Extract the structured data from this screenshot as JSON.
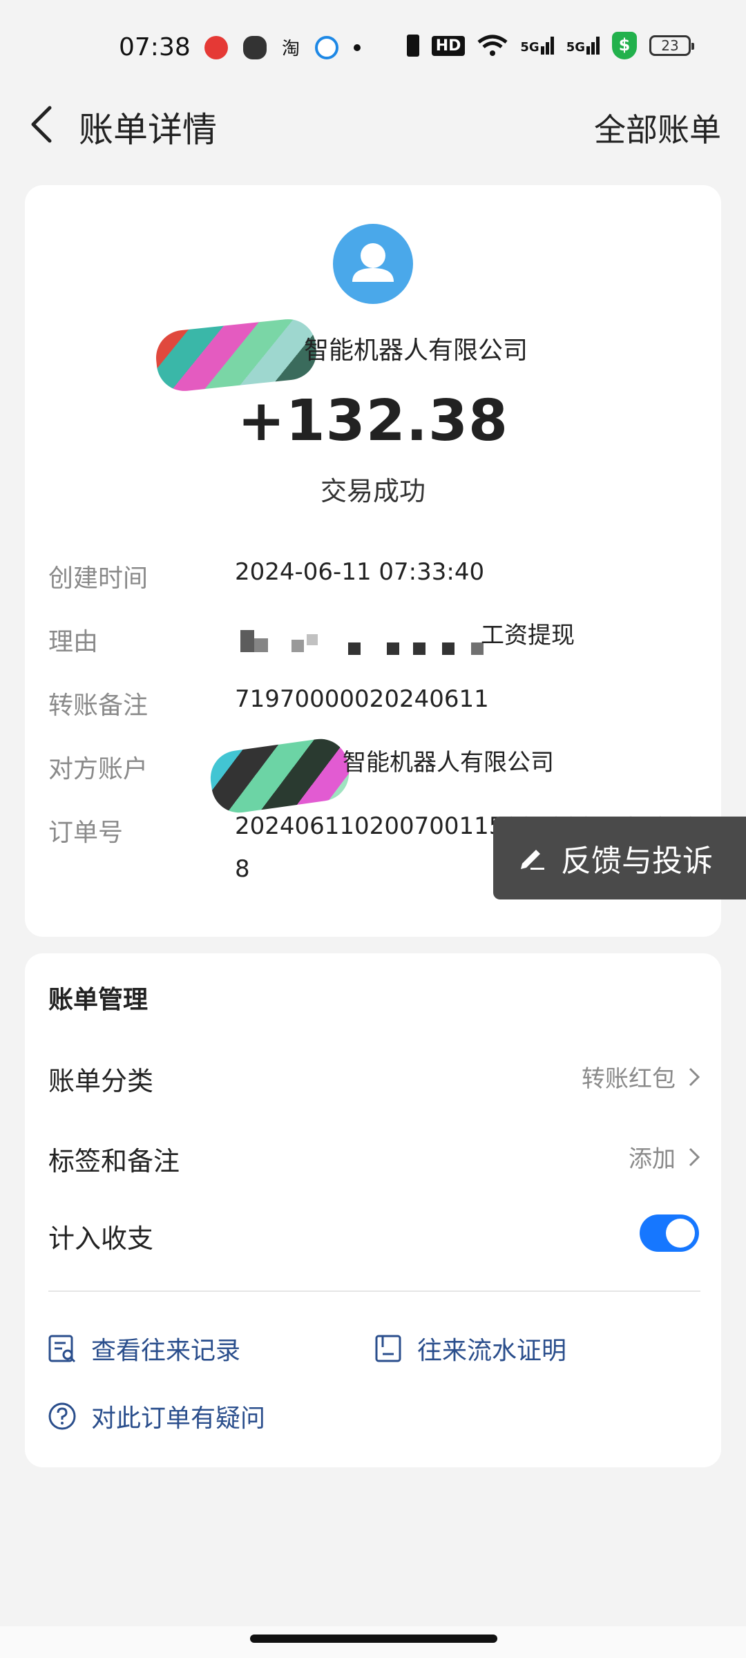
{
  "status_bar": {
    "time": "07:38",
    "network_labels": [
      "HD",
      "5G",
      "5G"
    ],
    "battery": "23",
    "icons": [
      "weibo-icon",
      "wechat-icon",
      "taobao-icon",
      "app-icon",
      "dot-icon",
      "vibrate-icon",
      "hd-icon",
      "wifi-icon",
      "signal-5g-icon",
      "signal-5g-icon",
      "security-shield-icon",
      "battery-icon"
    ]
  },
  "nav": {
    "title": "账单详情",
    "right_action": "全部账单"
  },
  "bill": {
    "payee_name_visible": "智能机器人有限公司",
    "amount": "+132.38",
    "status": "交易成功",
    "rows": [
      {
        "label": "创建时间",
        "value": "2024-06-11 07:33:40"
      },
      {
        "label": "理由",
        "value": "工资提现"
      },
      {
        "label": "转账备注",
        "value": "71970000020240611"
      },
      {
        "label": "对方账户",
        "value": "智能机器人有限公司"
      },
      {
        "label": "订单号",
        "value_line1": "20240611020070011500500036849​40",
        "value_line2": "8"
      }
    ]
  },
  "feedback_button": {
    "label": "反馈与投诉",
    "icon": "edit-icon"
  },
  "manage": {
    "title": "账单管理",
    "category_label": "账单分类",
    "category_value": "转账红包",
    "tags_label": "标签和备注",
    "tags_value": "添加",
    "include_label": "计入收支",
    "include_on": true,
    "links": {
      "records": "查看往来记录",
      "proof": "往来流水证明",
      "question": "对此订单有疑问"
    }
  },
  "colors": {
    "background": "#f3f3f3",
    "card": "#ffffff",
    "accent": "#1677ff",
    "link": "#2a4e8c",
    "avatar": "#4aa8ea"
  }
}
